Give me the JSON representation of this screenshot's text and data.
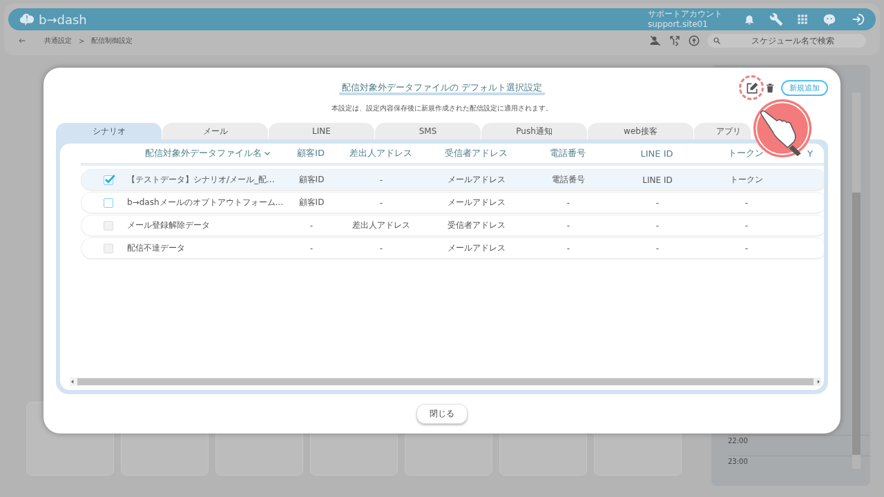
{
  "header": {
    "logo": "b→dash",
    "account_name": "サポートアカウント",
    "account_id": "support.site01"
  },
  "breadcrumb": {
    "items": [
      "共通設定",
      "配信制御設定"
    ],
    "separator": ">"
  },
  "search": {
    "placeholder": "スケジュール名で検索"
  },
  "schedule_panel": {
    "times": [
      "22:00",
      "23:00"
    ]
  },
  "dialog": {
    "title": "配信対象外データファイルの デフォルト選択設定",
    "subtitle": "本設定は、設定内容保存後に新規作成された配信設定に適用されます。",
    "add_button": "新規追加",
    "tabs": [
      {
        "label": "シナリオ",
        "selected": true
      },
      {
        "label": "メール",
        "selected": false
      },
      {
        "label": "LINE",
        "selected": false
      },
      {
        "label": "SMS",
        "selected": false
      },
      {
        "label": "Push通知",
        "selected": false
      },
      {
        "label": "web接客",
        "selected": false
      },
      {
        "label": "アプリ",
        "selected": false
      }
    ],
    "table": {
      "columns": [
        "配信対象外データファイル名",
        "顧客ID",
        "差出人アドレス",
        "受信者アドレス",
        "電話番号",
        "LINE ID",
        "トークン",
        "Y"
      ],
      "rows": [
        {
          "selected": true,
          "checked": true,
          "disabled": false,
          "cells": [
            "【テストデータ】シナリオ/メール_配...",
            "顧客ID",
            "-",
            "メールアドレス",
            "電話番号",
            "LINE ID",
            "トークン"
          ]
        },
        {
          "selected": false,
          "checked": false,
          "disabled": false,
          "cells": [
            "b→dashメールのオプトアウトフォーム...",
            "顧客ID",
            "-",
            "メールアドレス",
            "-",
            "-",
            "-"
          ]
        },
        {
          "selected": false,
          "checked": false,
          "disabled": true,
          "cells": [
            "メール登録解除データ",
            "-",
            "差出人アドレス",
            "受信者アドレス",
            "-",
            "-",
            "-"
          ]
        },
        {
          "selected": false,
          "checked": false,
          "disabled": true,
          "cells": [
            "配信不達データ",
            "-",
            "-",
            "メールアドレス",
            "-",
            "-",
            "-"
          ]
        }
      ]
    },
    "close_button": "閉じる"
  }
}
